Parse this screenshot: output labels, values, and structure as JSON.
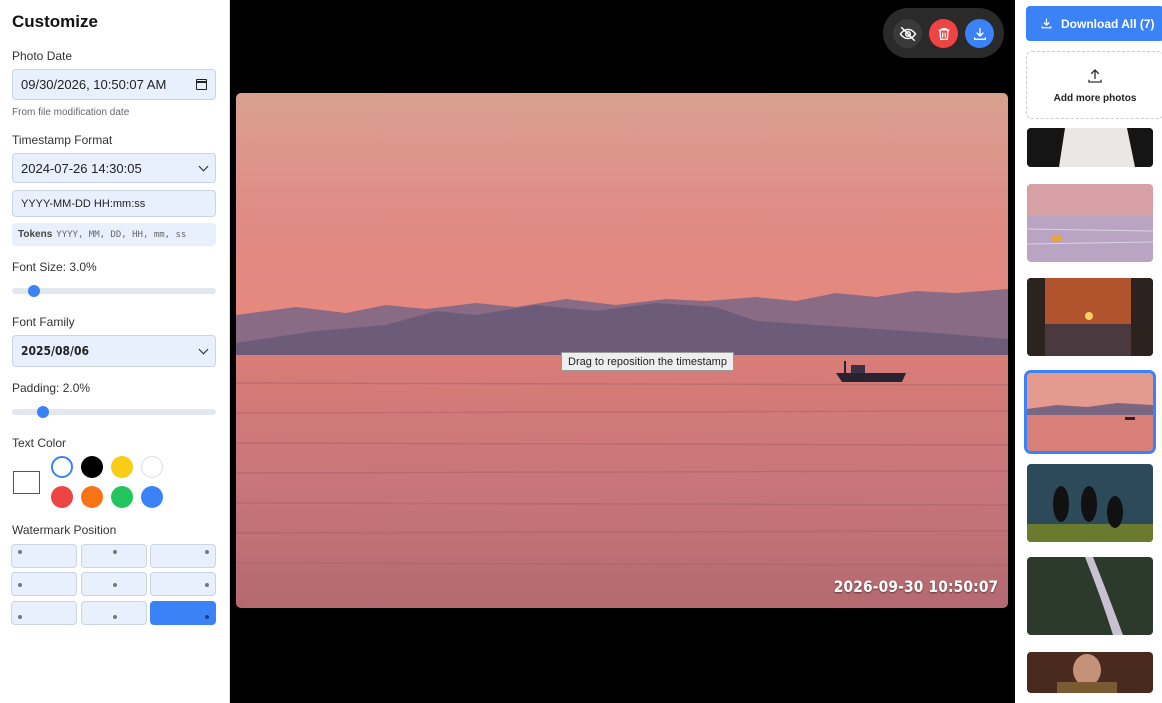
{
  "sidebar": {
    "title": "Customize",
    "photo_date": {
      "label": "Photo Date",
      "value": "09/30/2026, 10:50:07 AM",
      "hint": "From file modification date"
    },
    "timestamp_format": {
      "label": "Timestamp Format",
      "selected": "2024-07-26 14:30:05",
      "pattern": "YYYY-MM-DD HH:mm:ss",
      "tokens_label": "Tokens",
      "tokens": "YYYY, MM, DD, HH, mm, ss"
    },
    "font_size": {
      "label": "Font Size: 3.0%",
      "value_percent": 3.0
    },
    "font_family": {
      "label": "Font Family",
      "selected": "2025/08/06"
    },
    "padding": {
      "label": "Padding: 2.0%",
      "value_percent": 2.0
    },
    "text_color": {
      "label": "Text Color",
      "current": "#ffffff",
      "swatches": [
        "#ffffff",
        "#000000",
        "#facc15",
        "#ffffff",
        "#ef4444",
        "#f97316",
        "#22c55e",
        "#3b82f6"
      ]
    },
    "watermark_position": {
      "label": "Watermark Position",
      "selected": "bottom-right",
      "options": [
        "top-left",
        "top-center",
        "top-right",
        "middle-left",
        "center",
        "middle-right",
        "bottom-left",
        "bottom-center",
        "bottom-right"
      ]
    }
  },
  "toolbar": {
    "buttons": [
      {
        "name": "hide-preview-button",
        "icon": "eye-off-icon",
        "color": "#3a3a3a"
      },
      {
        "name": "delete-button",
        "icon": "trash-icon",
        "color": "#ef4444"
      },
      {
        "name": "download-button",
        "icon": "download-icon",
        "color": "#3b82f6"
      }
    ]
  },
  "preview": {
    "tooltip": "Drag to reposition the timestamp",
    "timestamp": "2026-09-30 10:50:07"
  },
  "gallery": {
    "download_all_label": "Download All (7)",
    "add_more_label": "Add more photos",
    "selected_index": 3,
    "accent": "#3b82f6"
  }
}
